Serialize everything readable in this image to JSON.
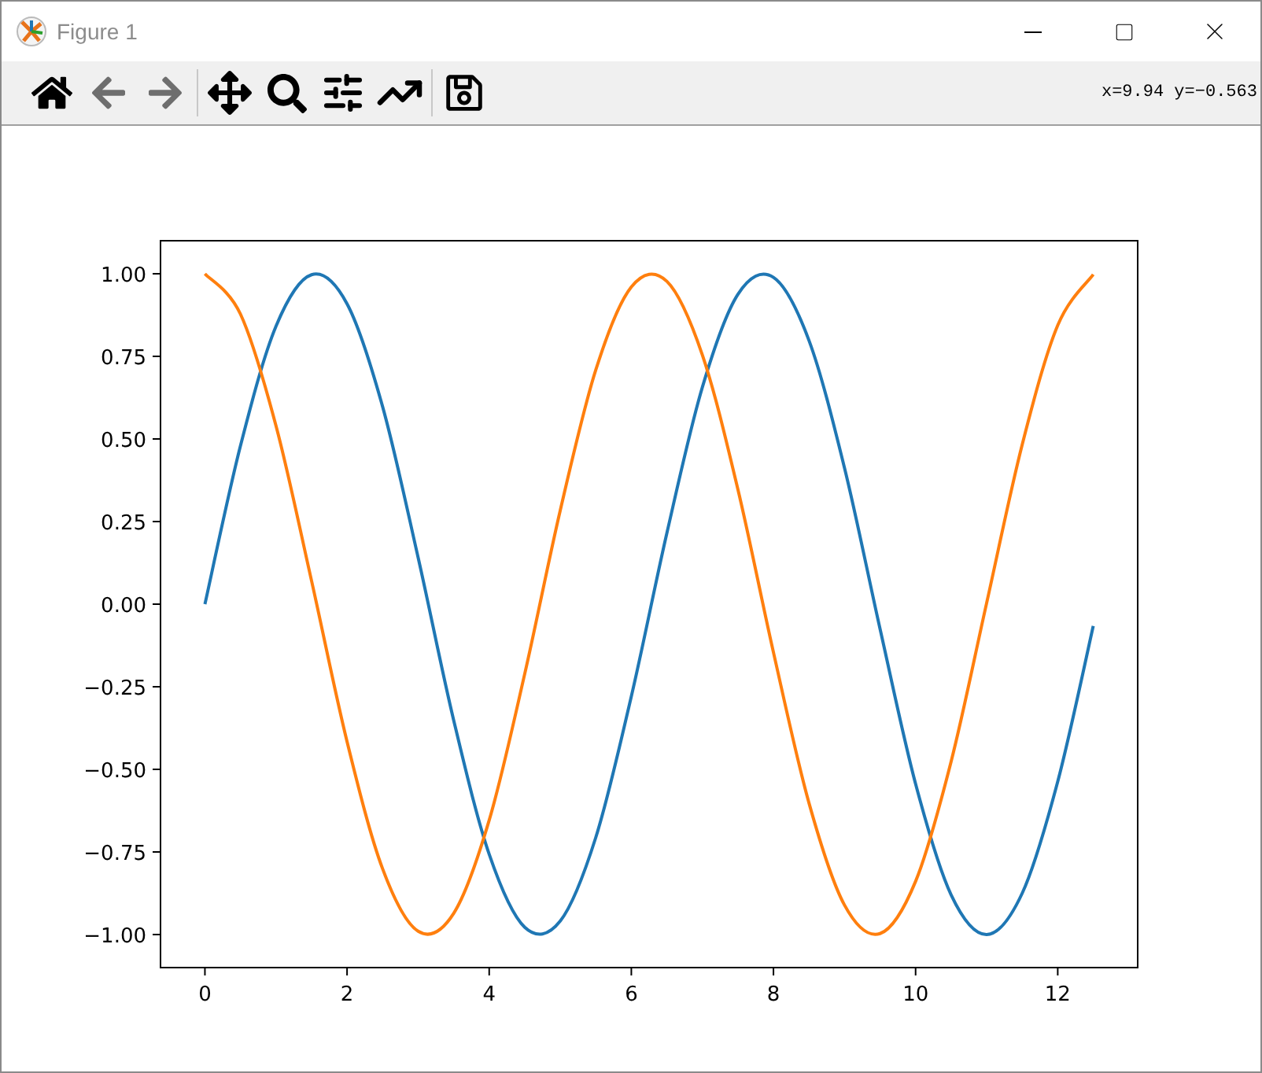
{
  "window": {
    "title": "Figure 1"
  },
  "toolbar": {
    "tools": [
      {
        "kind": "home",
        "disabled": false
      },
      {
        "kind": "back",
        "disabled": true
      },
      {
        "kind": "forward",
        "disabled": true
      },
      {
        "kind": "separator"
      },
      {
        "kind": "pan",
        "disabled": false
      },
      {
        "kind": "zoom",
        "disabled": false
      },
      {
        "kind": "subplots",
        "disabled": false
      },
      {
        "kind": "axes",
        "disabled": false
      },
      {
        "kind": "separator"
      },
      {
        "kind": "save",
        "disabled": false
      }
    ],
    "coordinates": "x=9.94 y=−0.563"
  },
  "figure": {
    "chart_data": {
      "type": "line",
      "x": [
        0,
        0.5,
        1,
        1.5,
        2,
        2.5,
        3,
        3.5,
        4,
        4.5,
        5,
        5.5,
        6,
        6.5,
        7,
        7.5,
        8,
        8.5,
        9,
        9.5,
        10,
        10.5,
        11,
        11.5,
        12,
        12.5
      ],
      "series": [
        {
          "color": "#1f77b4",
          "values": [
            0,
            0.479,
            0.841,
            0.997,
            0.909,
            0.598,
            0.141,
            -0.351,
            -0.757,
            -0.978,
            -0.959,
            -0.706,
            -0.279,
            0.215,
            0.657,
            0.938,
            0.989,
            0.798,
            0.412,
            -0.075,
            -0.544,
            -0.88,
            -1.0,
            -0.875,
            -0.537,
            -0.066
          ]
        },
        {
          "color": "#ff7f0e",
          "values": [
            1,
            0.878,
            0.54,
            0.071,
            -0.416,
            -0.801,
            -0.99,
            -0.936,
            -0.654,
            -0.211,
            0.284,
            0.709,
            0.96,
            0.977,
            0.754,
            0.347,
            -0.146,
            -0.602,
            -0.911,
            -0.997,
            -0.839,
            -0.476,
            0.004,
            0.483,
            0.844,
            0.998
          ]
        }
      ],
      "xlim": [
        -0.625,
        13.125
      ],
      "ylim": [
        -1.1,
        1.1
      ],
      "xticks": [
        {
          "value": 0,
          "label": "0"
        },
        {
          "value": 2,
          "label": "2"
        },
        {
          "value": 4,
          "label": "4"
        },
        {
          "value": 6,
          "label": "6"
        },
        {
          "value": 8,
          "label": "8"
        },
        {
          "value": 10,
          "label": "10"
        },
        {
          "value": 12,
          "label": "12"
        }
      ],
      "yticks": [
        {
          "value": 1,
          "label": "1.00"
        },
        {
          "value": 0.75,
          "label": "0.75"
        },
        {
          "value": 0.5,
          "label": "0.50"
        },
        {
          "value": 0.25,
          "label": "0.25"
        },
        {
          "value": 0,
          "label": "0.00"
        },
        {
          "value": -0.25,
          "label": "−0.25"
        },
        {
          "value": -0.5,
          "label": "−0.50"
        },
        {
          "value": -0.75,
          "label": "−0.75"
        },
        {
          "value": -1,
          "label": "−1.00"
        }
      ]
    }
  }
}
